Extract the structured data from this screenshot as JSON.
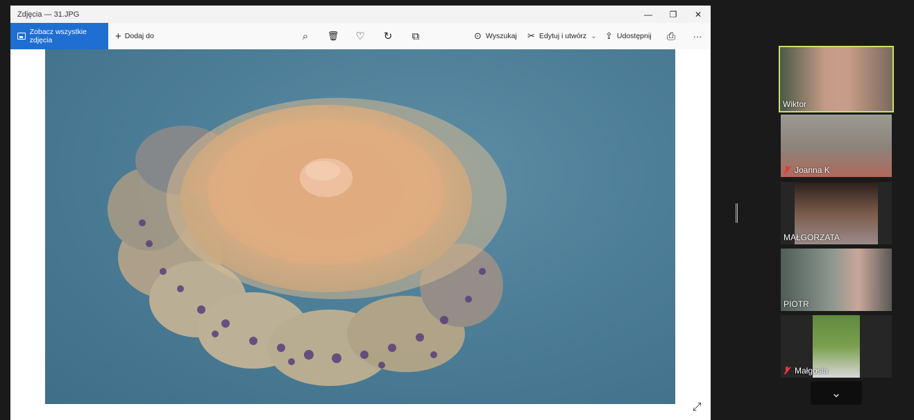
{
  "photos_app": {
    "title": "Zdjęcia — 31.JPG",
    "window_controls": {
      "minimize": "—",
      "maximize": "❐",
      "close": "✕"
    },
    "toolbar": {
      "see_all": "Zobacz wszystkie zdjęcia",
      "add_to": "Dodaj do",
      "zoom_glyph": "⌕",
      "delete_glyph": "🗑",
      "favorite_glyph": "♡",
      "rotate_glyph": "↻",
      "crop_glyph": "⧉",
      "search": "Wyszukaj",
      "edit_create": "Edytuj i utwórz",
      "share": "Udostępnij",
      "print_glyph": "⎙",
      "more": "···"
    },
    "expand_glyph": "⤢"
  },
  "participants": [
    {
      "name": "Wiktor",
      "muted": false,
      "active": true
    },
    {
      "name": "Joanna K",
      "muted": true,
      "active": false
    },
    {
      "name": "MAŁGORZATA",
      "muted": false,
      "active": false
    },
    {
      "name": "PIOTR",
      "muted": false,
      "active": false
    },
    {
      "name": "Małgosia",
      "muted": true,
      "active": false
    }
  ],
  "scroll_down_glyph": "⌄",
  "colors": {
    "accent": "#1f6fd2",
    "active_speaker": "#c9e265",
    "muted": "#e23b3b"
  }
}
